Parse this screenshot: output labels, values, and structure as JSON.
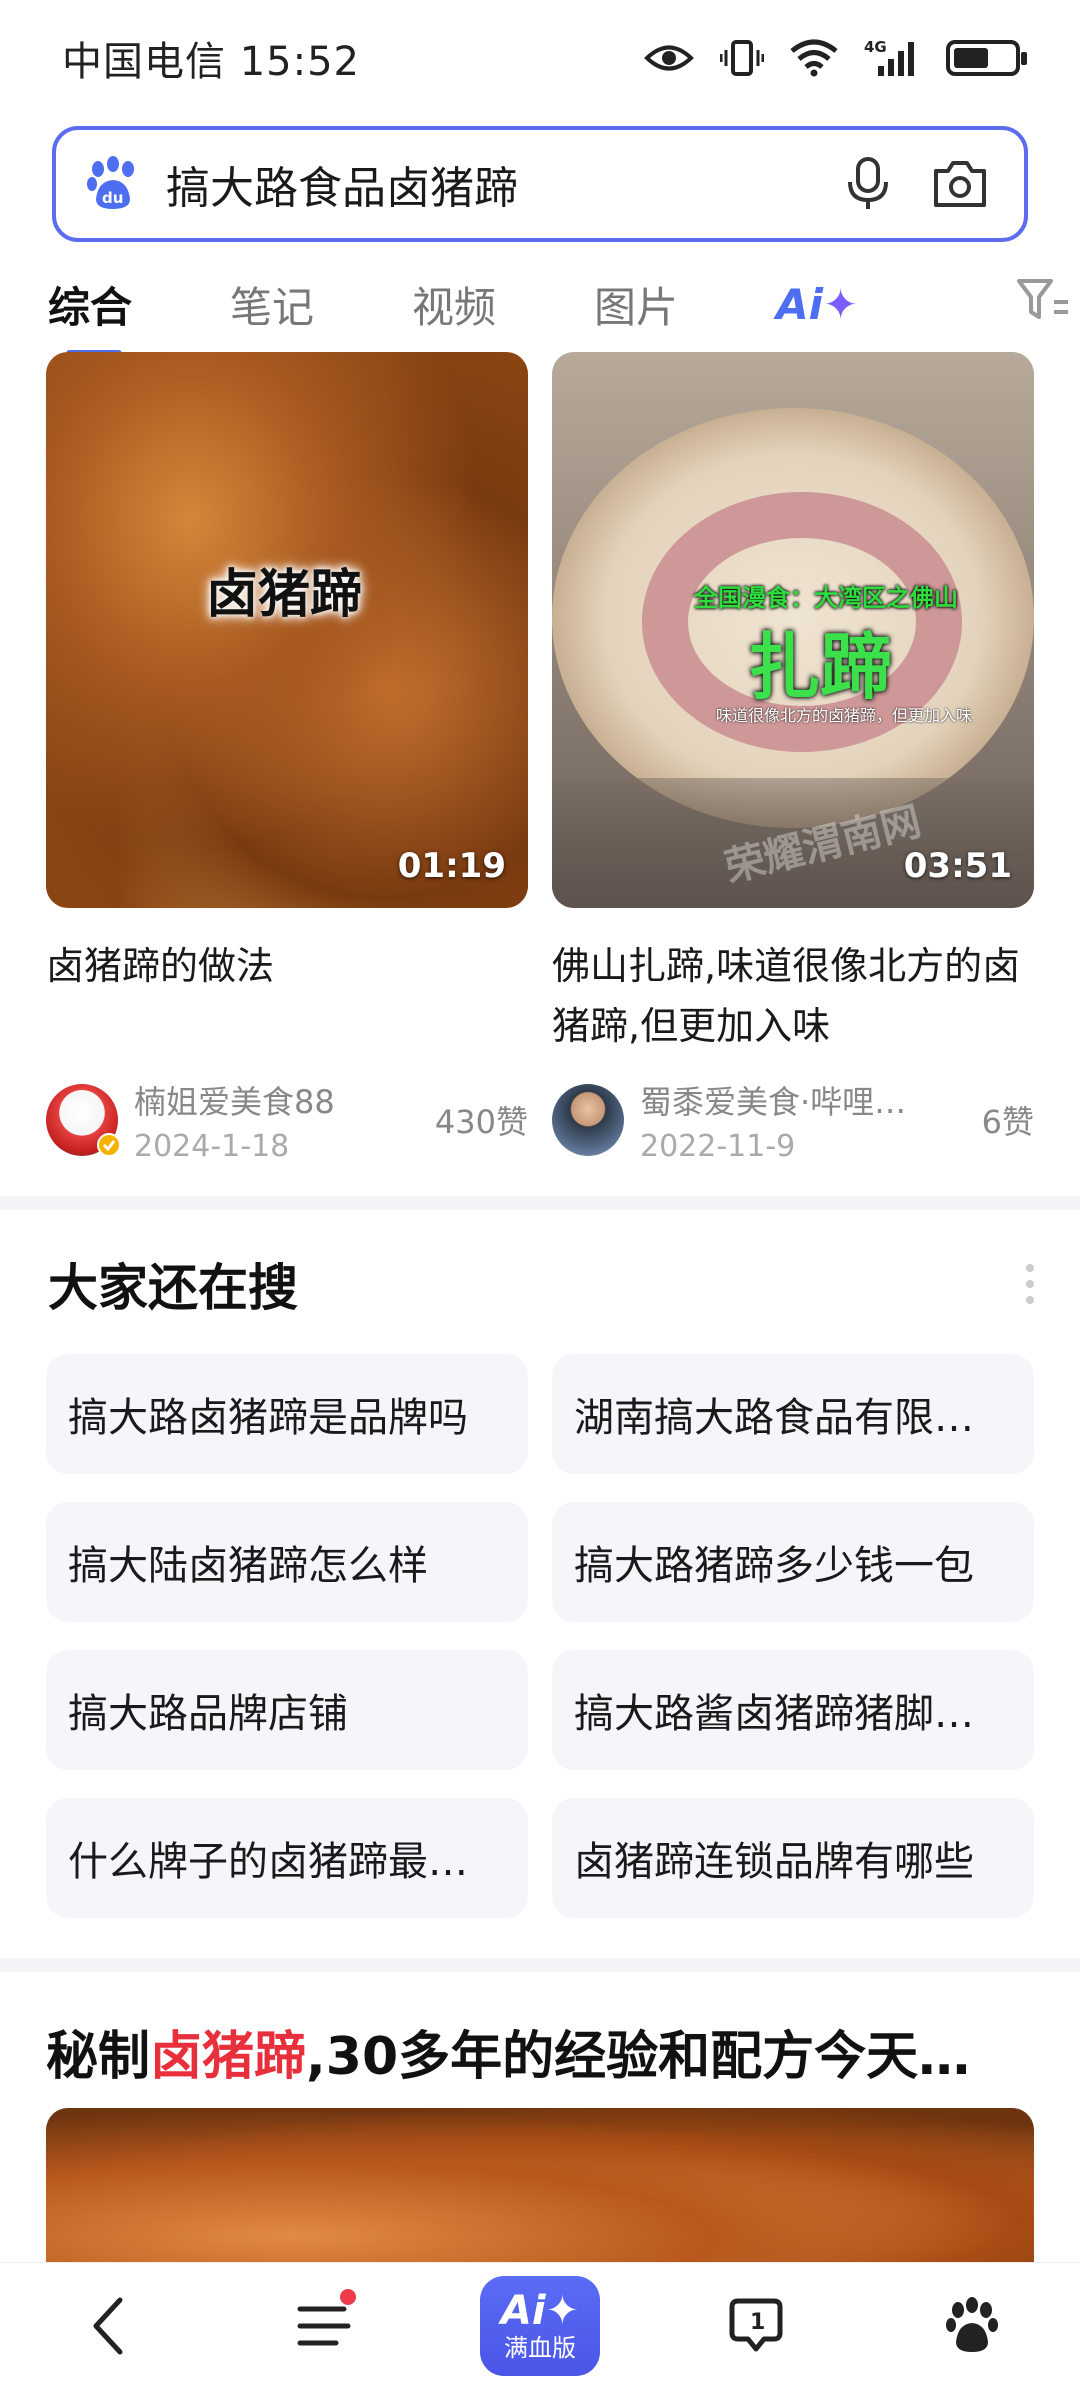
{
  "status_bar": {
    "carrier_time": "中国电信 15:52",
    "network": "4G",
    "battery_level": 0.55
  },
  "search": {
    "query": "搞大路食品卤猪蹄",
    "logo_text": "du"
  },
  "tabs": [
    {
      "label": "综合",
      "active": true
    },
    {
      "label": "笔记",
      "active": false
    },
    {
      "label": "视频",
      "active": false
    },
    {
      "label": "图片",
      "active": false
    },
    {
      "label": "Ai",
      "active": false
    }
  ],
  "videos": [
    {
      "thumb_label": "卤猪蹄",
      "duration": "01:19",
      "title": "卤猪蹄的做法",
      "author": "楠姐爱美食88",
      "date": "2024-1-18",
      "likes": "430赞"
    },
    {
      "thumb_label_top": "全国漫食：大湾区之佛山",
      "thumb_label_main": "扎蹄",
      "thumb_label_sub": "味道很像北方的卤猪蹄，但更加入味",
      "watermark": "荣耀渭南网",
      "duration": "03:51",
      "title": "佛山扎蹄,味道很像北方的卤猪蹄,但更加入味",
      "author": "蜀黍爱美食·哔哩…",
      "date": "2022-11-9",
      "likes": "6赞"
    }
  ],
  "related": {
    "title": "大家还在搜",
    "items": [
      "搞大路卤猪蹄是品牌吗",
      "湖南搞大路食品有限…",
      "搞大陆卤猪蹄怎么样",
      "搞大路猪蹄多少钱一包",
      "搞大路品牌店铺",
      "搞大路酱卤猪蹄猪脚…",
      "什么牌子的卤猪蹄最…",
      "卤猪蹄连锁品牌有哪些"
    ]
  },
  "article": {
    "title_prefix": "秘制",
    "title_highlight": "卤猪蹄",
    "title_suffix": ",30多年的经验和配方今天…"
  },
  "bottom_nav": {
    "ai_label": "Ai",
    "ai_sub": "满血版",
    "badge_count": "1"
  },
  "colors": {
    "accent": "#4e6ef2",
    "highlight": "#e8303c"
  }
}
